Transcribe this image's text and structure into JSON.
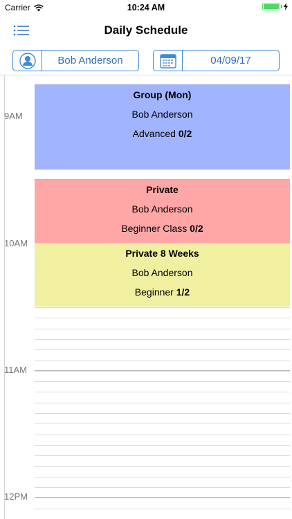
{
  "status_bar": {
    "carrier": "Carrier",
    "time": "10:24 AM"
  },
  "nav": {
    "title": "Daily Schedule",
    "menu_icon": "list-icon"
  },
  "member_selector": {
    "icon": "person-icon",
    "value": "Bob Anderson"
  },
  "date_selector": {
    "icon": "calendar-icon",
    "value": "04/09/17"
  },
  "hours": [
    "9AM",
    "10AM",
    "11AM",
    "12PM"
  ],
  "events": [
    {
      "title": "Group (Mon)",
      "instructor": "Bob Anderson",
      "level": "Advanced",
      "capacity": "0/2",
      "color": "#a0b4ff"
    },
    {
      "title": "Private",
      "instructor": "Bob Anderson",
      "level": "Beginner Class",
      "capacity": "0/2",
      "color": "#ffa7a7"
    },
    {
      "title": "Private 8 Weeks",
      "instructor": "Bob Anderson",
      "level": "Beginner",
      "capacity": "1/2",
      "color": "#f1f0a0"
    }
  ],
  "colors": {
    "accent": "#3d8bd9",
    "battery": "#4cd964"
  }
}
